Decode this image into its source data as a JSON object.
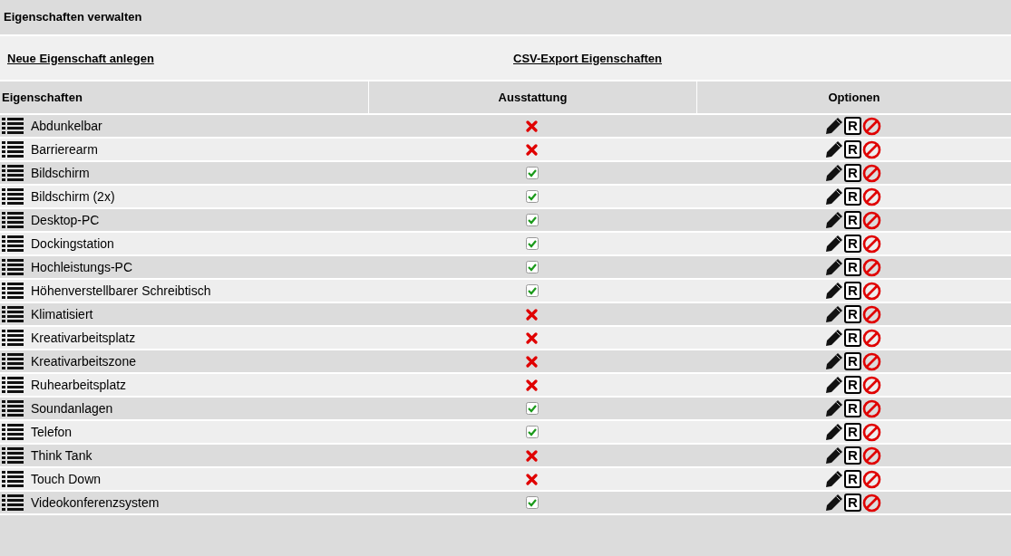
{
  "title": "Eigenschaften verwalten",
  "links": [
    "Neue Eigenschaft anlegen",
    "CSV-Export Eigenschaften"
  ],
  "columns": [
    "Eigenschaften",
    "Ausstattung",
    "Optionen"
  ],
  "rows": [
    {
      "name": "Abdunkelbar",
      "equipped": false,
      "r_label": "R"
    },
    {
      "name": "Barrierearm",
      "equipped": false,
      "r_label": "R"
    },
    {
      "name": "Bildschirm",
      "equipped": true,
      "r_label": "R"
    },
    {
      "name": "Bildschirm (2x)",
      "equipped": true,
      "r_label": "R"
    },
    {
      "name": "Desktop-PC",
      "equipped": true,
      "r_label": "R"
    },
    {
      "name": "Dockingstation",
      "equipped": true,
      "r_label": "R"
    },
    {
      "name": "Hochleistungs-PC",
      "equipped": true,
      "r_label": "R"
    },
    {
      "name": "Höhenverstellbarer Schreibtisch",
      "equipped": true,
      "r_label": "R"
    },
    {
      "name": "Klimatisiert",
      "equipped": false,
      "r_label": "R"
    },
    {
      "name": "Kreativarbeitsplatz",
      "equipped": false,
      "r_label": "R"
    },
    {
      "name": "Kreativarbeitszone",
      "equipped": false,
      "r_label": "R"
    },
    {
      "name": "Ruhearbeitsplatz",
      "equipped": false,
      "r_label": "R"
    },
    {
      "name": "Soundanlagen",
      "equipped": true,
      "r_label": "R"
    },
    {
      "name": "Telefon",
      "equipped": true,
      "r_label": "R"
    },
    {
      "name": "Think Tank",
      "equipped": false,
      "r_label": "R"
    },
    {
      "name": "Touch Down",
      "equipped": false,
      "r_label": "R"
    },
    {
      "name": "Videokonferenzsystem",
      "equipped": true,
      "r_label": "R"
    }
  ]
}
